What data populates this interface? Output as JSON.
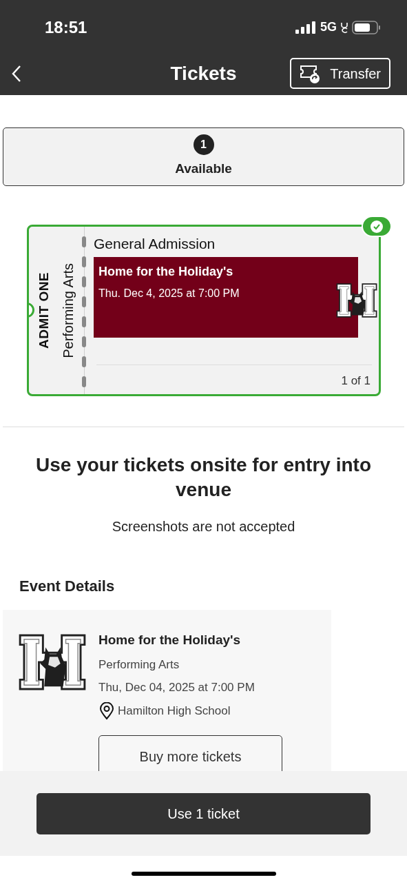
{
  "status_bar": {
    "time": "18:51",
    "network": "5G"
  },
  "header": {
    "title": "Tickets",
    "transfer_button": "Transfer"
  },
  "availability": {
    "count": "1",
    "label": "Available"
  },
  "ticket": {
    "admit": "ADMIT ONE",
    "category": "Performing Arts",
    "section": "General Admission",
    "event_title": "Home for the Holiday's",
    "datetime": "Thu. Dec 4, 2025 at 7:00 PM",
    "counter": "1 of 1",
    "verified": true
  },
  "notice": {
    "heading": "Use your tickets onsite for entry into venue",
    "subtext": "Screenshots are not accepted"
  },
  "event_details": {
    "heading": "Event Details",
    "title": "Home for the Holiday's",
    "category": "Performing Arts",
    "datetime": "Thu, Dec 04, 2025 at 7:00 PM",
    "venue": "Hamilton High School",
    "buy_button": "Buy more tickets"
  },
  "use_button": "Use 1 ticket"
}
